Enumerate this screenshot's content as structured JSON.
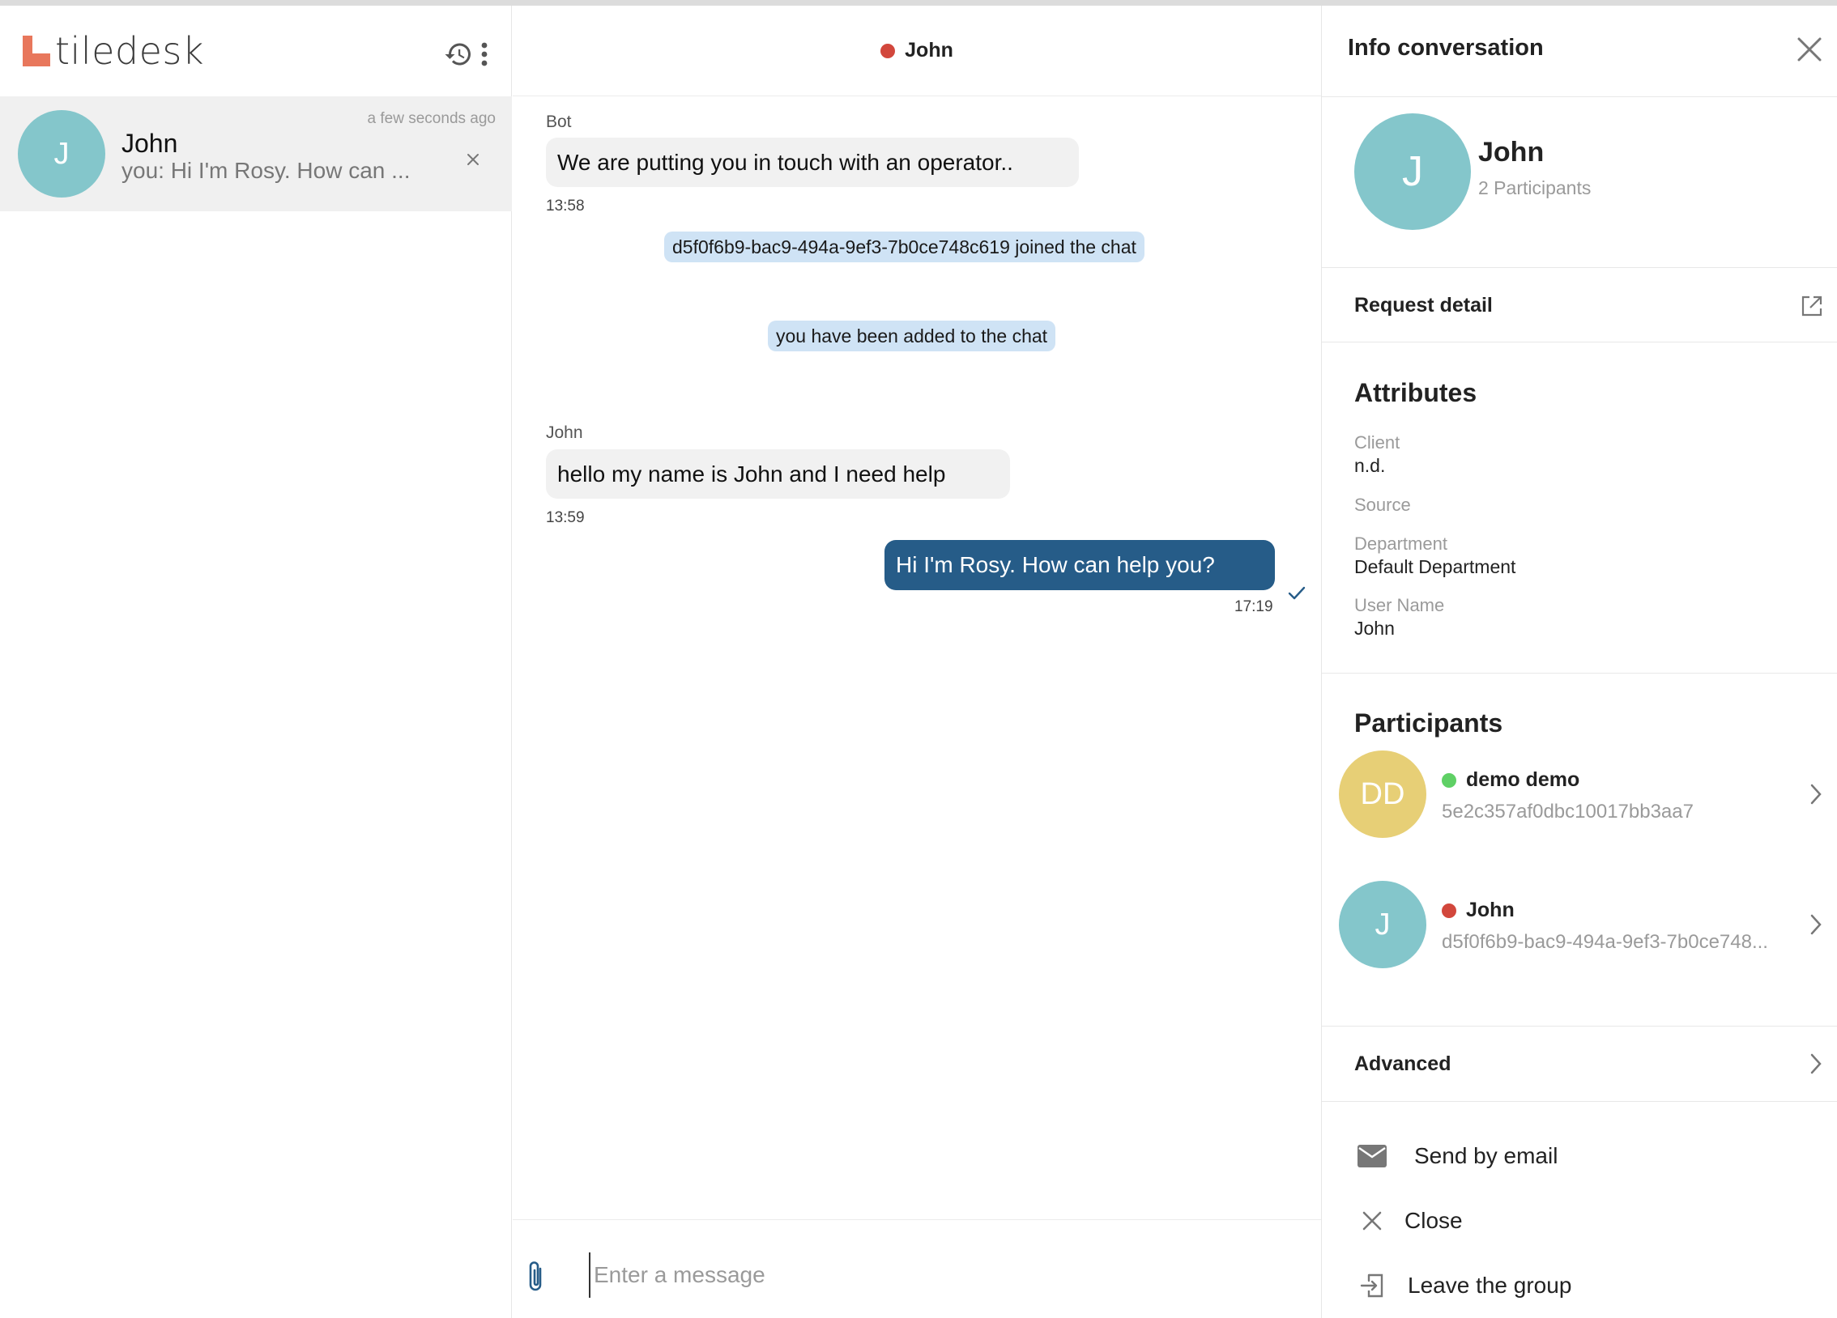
{
  "app": {
    "brand": "tiledesk"
  },
  "left_panel": {
    "conversation": {
      "avatar_initial": "J",
      "name": "John",
      "preview": "you: Hi I'm Rosy. How can ...",
      "time": "a few seconds ago"
    }
  },
  "center_panel": {
    "header": {
      "title": "John",
      "status": "offline"
    },
    "messages": [
      {
        "sender": "Bot",
        "text": "We are putting you in touch with an operator..",
        "time": "13:58"
      },
      {
        "system": "d5f0f6b9-bac9-494a-9ef3-7b0ce748c619 joined the chat"
      },
      {
        "system": "you have been added to the chat"
      },
      {
        "sender": "John",
        "text": "hello my name is John and I need help",
        "time": "13:59"
      },
      {
        "text": "Hi I'm Rosy. How can help you?",
        "time": "17:19",
        "outgoing": true
      }
    ],
    "input": {
      "placeholder": "Enter a message"
    }
  },
  "right_panel": {
    "title": "Info conversation",
    "profile": {
      "initial": "J",
      "name": "John",
      "participants_count": "2 Participants"
    },
    "request_detail": "Request detail",
    "attributes": {
      "title": "Attributes",
      "items": [
        {
          "key": "Client",
          "value": "n.d."
        },
        {
          "key": "Source",
          "value": ""
        },
        {
          "key": "Department",
          "value": "Default Department"
        },
        {
          "key": "User Name",
          "value": "John"
        }
      ]
    },
    "participants": {
      "title": "Participants",
      "items": [
        {
          "initials": "DD",
          "name": "demo demo",
          "id": "5e2c357af0dbc10017bb3aa7",
          "status": "online",
          "color": "#e7cf76"
        },
        {
          "initials": "J",
          "name": "John",
          "id": "d5f0f6b9-bac9-494a-9ef3-7b0ce748...",
          "status": "offline",
          "color": "#84c6cb"
        }
      ]
    },
    "advanced": "Advanced",
    "actions": [
      {
        "label": "Send by email",
        "icon": "mail-icon"
      },
      {
        "label": "Close",
        "icon": "close-icon"
      },
      {
        "label": "Leave the group",
        "icon": "exit-icon"
      }
    ]
  },
  "colors": {
    "brand": "#e8775c",
    "outgoing_bubble": "#265c88",
    "system_bubble": "#cfe3f5",
    "avatar_teal": "#84c6cb",
    "avatar_yellow": "#e7cf76",
    "status_offline": "#d2473c",
    "status_online": "#5fd065"
  }
}
